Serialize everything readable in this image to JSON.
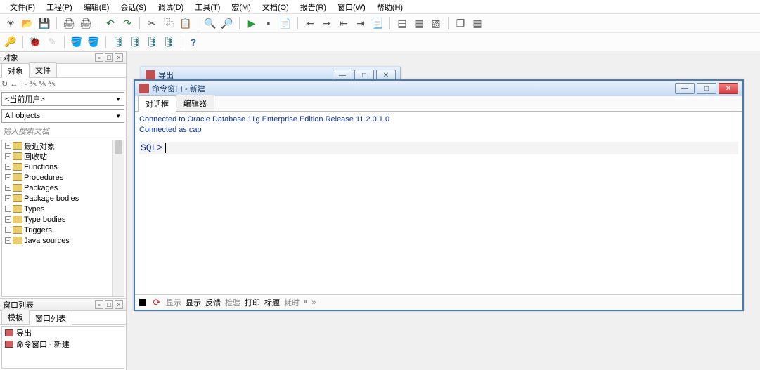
{
  "menu": [
    "文件(F)",
    "工程(P)",
    "编辑(E)",
    "会话(S)",
    "调试(D)",
    "工具(T)",
    "宏(M)",
    "文档(O)",
    "报告(R)",
    "窗口(W)",
    "帮助(H)"
  ],
  "left": {
    "objects_title": "对象",
    "tabs": [
      "对象",
      "文件"
    ],
    "user_combo": "<当前用户>",
    "filter_combo": "All objects",
    "search_placeholder": "输入搜索文档",
    "tree": [
      "最近对象",
      "回收站",
      "Functions",
      "Procedures",
      "Packages",
      "Package bodies",
      "Types",
      "Type bodies",
      "Triggers",
      "Java sources"
    ],
    "winlist_title": "窗口列表",
    "winlist_tabs": [
      "模板",
      "窗口列表"
    ],
    "winlist_items": [
      "导出",
      "命令窗口 - 新建"
    ]
  },
  "child_back": {
    "title": "导出"
  },
  "child_front": {
    "title": "命令窗口 - 新建",
    "tabs": [
      "对话框",
      "编辑器"
    ],
    "lines": [
      "Connected to Oracle Database 11g Enterprise Edition Release 11.2.0.1.0",
      "Connected as cap"
    ],
    "prompt": "SQL> ",
    "status": [
      "显示",
      "显示",
      "反馈",
      "检验",
      "打印",
      "标题",
      "耗时"
    ]
  }
}
